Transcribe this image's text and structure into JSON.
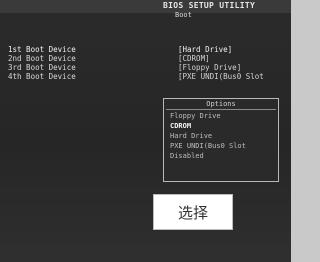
{
  "header": {
    "title": "BIOS SETUP UTILITY",
    "tab": "Boot"
  },
  "boot_devices": [
    {
      "label": "1st Boot Device",
      "value": "[Hard Drive]",
      "selected": true
    },
    {
      "label": "2nd Boot Device",
      "value": "[CDROM]",
      "selected": false
    },
    {
      "label": "3rd Boot Device",
      "value": "[Floppy Drive]",
      "selected": false
    },
    {
      "label": "4th Boot Device",
      "value": "[PXE UNDI(Bus0 Slot",
      "selected": false
    }
  ],
  "options_popup": {
    "header": "Options",
    "items": [
      {
        "label": "Floppy Drive",
        "highlighted": false
      },
      {
        "label": "CDROM",
        "highlighted": true
      },
      {
        "label": "Hard Drive",
        "highlighted": false
      },
      {
        "label": "PXE UNDI(Bus0 Slot",
        "highlighted": false
      },
      {
        "label": "Disabled",
        "highlighted": false
      }
    ]
  },
  "caption": {
    "text": "选择"
  }
}
